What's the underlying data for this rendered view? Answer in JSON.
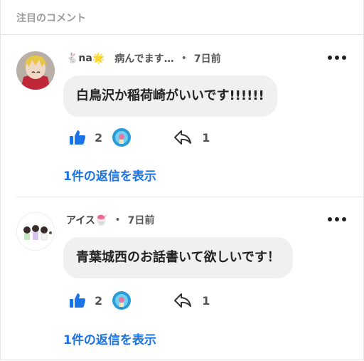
{
  "section": {
    "title": "注目のコメント"
  },
  "comments": [
    {
      "author": "🐇na🌟",
      "status": "病んでます…",
      "separator": "•",
      "time": "7日前",
      "text": "白鳥沢か稲荷崎がいいです!!!!!!",
      "likes": "2",
      "replies": "1",
      "show_replies": "1件の返信を表示"
    },
    {
      "author": "アイス🍧",
      "separator": "•",
      "time": "7日前",
      "text": "青葉城西のお話書いて欲しいです！",
      "likes": "2",
      "replies": "1",
      "show_replies": "1件の返信を表示"
    }
  ],
  "colors": {
    "accent": "#1a73e8",
    "bubble": "#f0f0f0",
    "muted": "#9a9a9a"
  },
  "icons": [
    "thumbs-up-icon",
    "reply-arrow-icon",
    "more-options-icon"
  ]
}
